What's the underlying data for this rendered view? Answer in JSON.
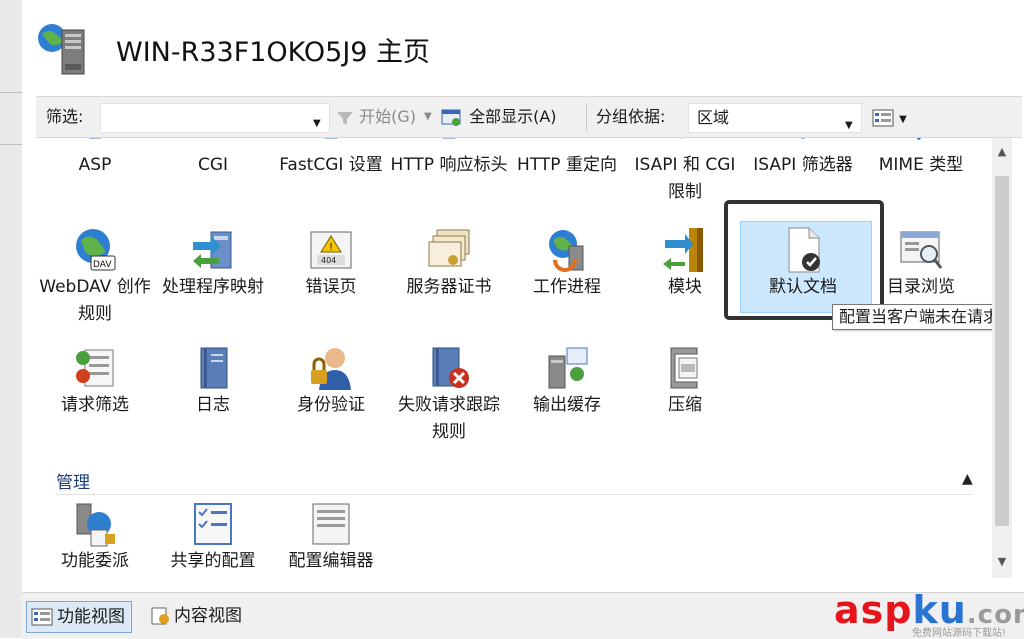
{
  "window": {
    "title": "WIN-R33F1OKO5J9 主页"
  },
  "toolbar": {
    "filter_label": "筛选:",
    "filter_value": "",
    "start_label": "开始(G)",
    "show_all_label": "全部显示(A)",
    "group_by_label": "分组依据:",
    "group_by_value": "区域"
  },
  "features_row1": [
    {
      "label": "ASP",
      "icon": "asp-icon"
    },
    {
      "label": "CGI",
      "icon": "cgi-icon"
    },
    {
      "label": "FastCGI 设置",
      "icon": "fastcgi-icon"
    },
    {
      "label": "HTTP 响应标头",
      "icon": "http-response-headers-icon"
    },
    {
      "label": "HTTP 重定向",
      "icon": "http-redirect-icon"
    },
    {
      "label": "ISAPI 和 CGI 限制",
      "icon": "isapi-cgi-restrictions-icon"
    },
    {
      "label": "ISAPI 筛选器",
      "icon": "isapi-filters-icon"
    },
    {
      "label": "MIME 类型",
      "icon": "mime-types-icon"
    }
  ],
  "features_row2": [
    {
      "label": "WebDAV 创作规则",
      "icon": "webdav-icon"
    },
    {
      "label": "处理程序映射",
      "icon": "handler-mappings-icon"
    },
    {
      "label": "错误页",
      "icon": "error-pages-icon"
    },
    {
      "label": "服务器证书",
      "icon": "server-certificates-icon"
    },
    {
      "label": "工作进程",
      "icon": "worker-processes-icon"
    },
    {
      "label": "模块",
      "icon": "modules-icon"
    },
    {
      "label": "默认文档",
      "icon": "default-document-icon"
    },
    {
      "label": "目录浏览",
      "icon": "directory-browsing-icon"
    }
  ],
  "features_row3": [
    {
      "label": "请求筛选",
      "icon": "request-filtering-icon"
    },
    {
      "label": "日志",
      "icon": "logging-icon"
    },
    {
      "label": "身份验证",
      "icon": "authentication-icon"
    },
    {
      "label": "失败请求跟踪规则",
      "icon": "failed-request-tracing-icon"
    },
    {
      "label": "输出缓存",
      "icon": "output-caching-icon"
    },
    {
      "label": "压缩",
      "icon": "compression-icon"
    }
  ],
  "management": {
    "header": "管理",
    "items": [
      {
        "label": "功能委派",
        "icon": "feature-delegation-icon"
      },
      {
        "label": "共享的配置",
        "icon": "shared-configuration-icon"
      },
      {
        "label": "配置编辑器",
        "icon": "configuration-editor-icon"
      }
    ]
  },
  "tooltip": "配置当客户端未在请求",
  "bottom": {
    "features_view": "功能视图",
    "content_view": "内容视图"
  },
  "watermark": {
    "a": "asp",
    "b": "ku",
    "c": ".com",
    "sub": "免费网站源码下载站!"
  },
  "colors": {
    "selection": "#cce8ff",
    "section_header": "#1e3c78",
    "watermark_red": "#e5151b",
    "watermark_blue": "#2b73d1"
  }
}
